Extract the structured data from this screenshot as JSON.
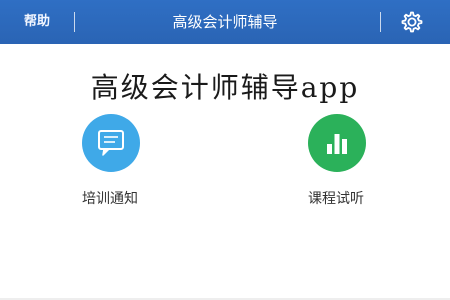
{
  "header": {
    "help_label": "帮助",
    "title": "高级会计师辅导",
    "settings_icon": "gear-icon"
  },
  "overlay": {
    "caption": "高级会计师辅导app"
  },
  "tiles": [
    {
      "label": "培训通知",
      "icon": "chat-bubble-icon",
      "color": "#3fa9e8"
    },
    {
      "label": "课程试听",
      "icon": "bar-chart-icon",
      "color": "#2bb15a"
    }
  ],
  "theme": {
    "header_color": "#2f6fc4"
  }
}
